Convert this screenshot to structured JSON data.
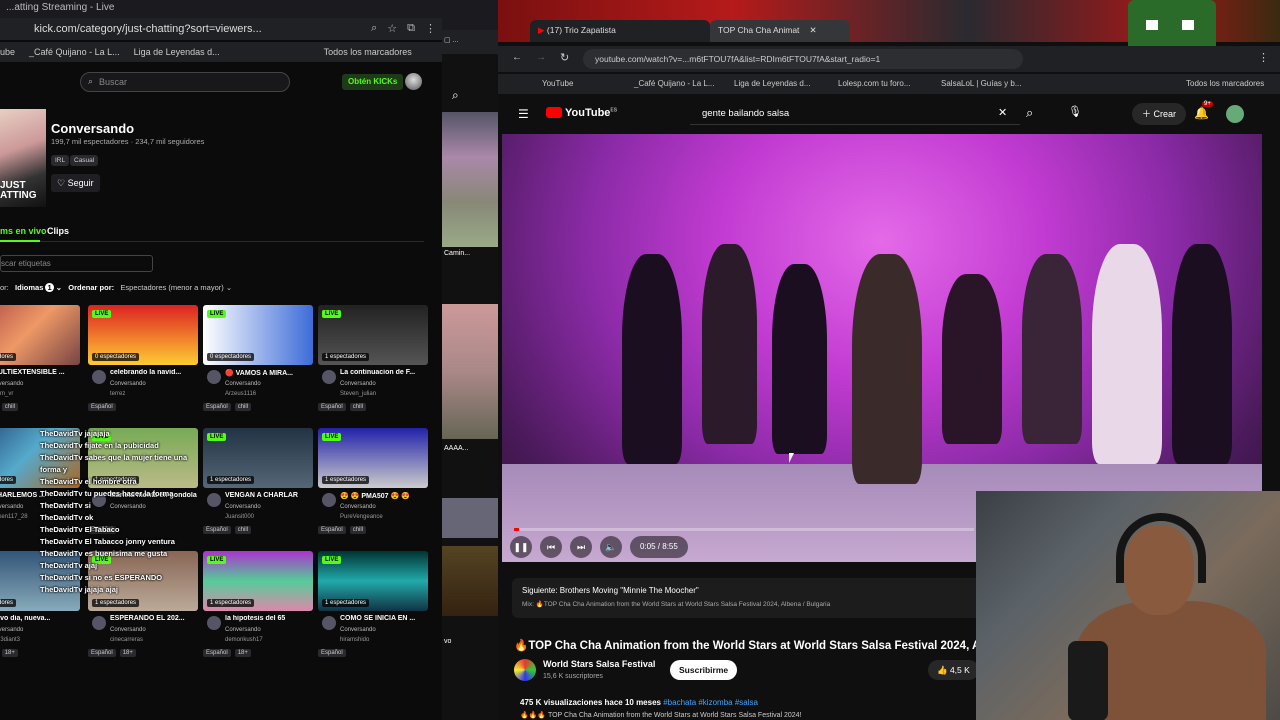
{
  "left": {
    "tab_title": "...atting Streaming - Live",
    "url": "kick.com/category/just-chatting?sort=viewers...",
    "bookmarks": [
      "ube",
      "_Café Quijano - La L...",
      "Liga de Leyendas d...",
      "Todos los marcadores"
    ],
    "search_placeholder": "Buscar",
    "kicks_button": "Obtén KICKs",
    "category_img_text": "JUST\nATTING",
    "category": {
      "name": "Conversando",
      "spectators": "199,7 mil espectadores",
      "followers": "234,7 mil seguidores",
      "tags": [
        "IRL",
        "Casual"
      ],
      "follow": "Seguir"
    },
    "tabs": {
      "live": "ms en vivo",
      "clips": "Clips"
    },
    "tag_filter_placeholder": "scar etiquetas",
    "filters": {
      "prefix": "or:",
      "languages": "Idiomas",
      "lang_count": "1",
      "sort_label": "Ordenar por:",
      "sort_value": "Espectadores (menor a mayor)"
    },
    "cards": [
      {
        "title": "MULTIEXTENSIBLE ...",
        "viewers": "espectadores",
        "cat": "onversando",
        "user": "olem_vr",
        "tags": [
          "Español",
          "chill"
        ]
      },
      {
        "title": "celebrando la navid...",
        "viewers": "0 espectadores",
        "cat": "Conversando",
        "user": "terrez",
        "tags": [
          "Español"
        ]
      },
      {
        "title": "🔴 VAMOS A MIRA...",
        "viewers": "0 espectadores",
        "cat": "Conversando",
        "user": "Arzeus1116",
        "tags": [
          "Español",
          "chill"
        ]
      },
      {
        "title": "La continuacion de F...",
        "viewers": "1 espectadores",
        "cat": "Conversando",
        "user": "Steven_julian",
        "tags": [
          "Español",
          "chill"
        ]
      },
      {
        "title": "CHARLEMOS ...",
        "viewers": "espectadores",
        "cat": "onversando",
        "user": "ekken117_28",
        "tags": [
          "Español"
        ]
      },
      {
        "title": "Marieta monta en gondola",
        "viewers": "1 espectadores",
        "cat": "Conversando",
        "user": "",
        "tags": [
          "Español"
        ]
      },
      {
        "title": "VENGAN A CHARLAR",
        "viewers": "1 espectadores",
        "cat": "Conversando",
        "user": "Juansit000",
        "tags": [
          "Español",
          "chill"
        ]
      },
      {
        "title": "😍 😍 PMA507 😍 😍",
        "viewers": "1 espectadores",
        "cat": "Conversando",
        "user": "PureVengeance",
        "tags": [
          "Español",
          "chill"
        ]
      },
      {
        "title": "uevo dia, nueva...",
        "viewers": "espectadores",
        "cat": "onversando",
        "user": "0m3diant3",
        "tags": [
          "Español",
          "18+"
        ]
      },
      {
        "title": "ESPERANDO EL 202...",
        "viewers": "1 espectadores",
        "cat": "Conversando",
        "user": "cinecarreras",
        "tags": [
          "Español",
          "18+"
        ]
      },
      {
        "title": "la hipotesis del 65",
        "viewers": "1 espectadores",
        "cat": "Conversando",
        "user": "demonkush17",
        "tags": [
          "Español",
          "18+"
        ]
      },
      {
        "title": "COMO SE INICIA EN ...",
        "viewers": "1 espectadores",
        "cat": "Conversando",
        "user": "hiramshido",
        "tags": [
          "Español"
        ]
      }
    ],
    "chat_lines": [
      "TheDavidTv jajajaja",
      "TheDavidTv fijate en la pubicidad",
      "TheDavidTv sabes que la mujer tiene una forma y",
      "TheDavidTv el hombre otra",
      "TheDavidTv tu puedes hacer la forma",
      "TheDavidTv si",
      "TheDavidTv ok",
      "TheDavidTv El Tabaco",
      "TheDavidTv El Tabacco jonny ventura",
      "TheDavidTv es buenisima me gusta",
      "TheDavidTv ajaj",
      "TheDavidTv si no es ESPERANDO",
      "TheDavidTv jajaja ajaj"
    ]
  },
  "mid": {
    "labels": [
      "Camin...",
      "AAAA...",
      "vo"
    ]
  },
  "right": {
    "tabs": [
      "(17) Trio Zapatista",
      "TOP Cha Cha Animat"
    ],
    "url": "youtube.com/watch?v=...m6tFTOU7fA&list=RDIm6tFTOU7fA&start_radio=1",
    "bookmarks": [
      "YouTube",
      "_Café Quijano - La L...",
      "Liga de Leyendas d...",
      "Lolesp.com tu foro...",
      "SalsaLoL | Guías y b...",
      "Todos los marcadores"
    ],
    "yt_logo": "YouTube",
    "yt_country": "ES",
    "search_query": "gente bailando salsa",
    "create": "Crear",
    "notif_count": "9+",
    "time": "0:05 / 8:55",
    "progress": 0.01,
    "next_label": "Siguiente: Brothers Moving \"Minnie The Moocher\"",
    "mix_label": "Mix: 🔥TOP Cha Cha Animation from the World Stars at World Stars Salsa Festival 2024, Albena / Bulgaria",
    "title": "🔥TOP Cha Cha Animation from the World Stars at World Stars Salsa Festival 2024, All",
    "channel": "World Stars Salsa Festival",
    "subs": "15,6 K suscriptores",
    "subscribe": "Suscribirme",
    "likes": "4,5 K",
    "views": "475 K visualizaciones  hace 10 meses",
    "hashtags": "#bachata #kizomba #salsa",
    "desc": "🔥🔥🔥 TOP Cha Cha Animation from the World Stars at World Stars Salsa Festival 2024!"
  }
}
